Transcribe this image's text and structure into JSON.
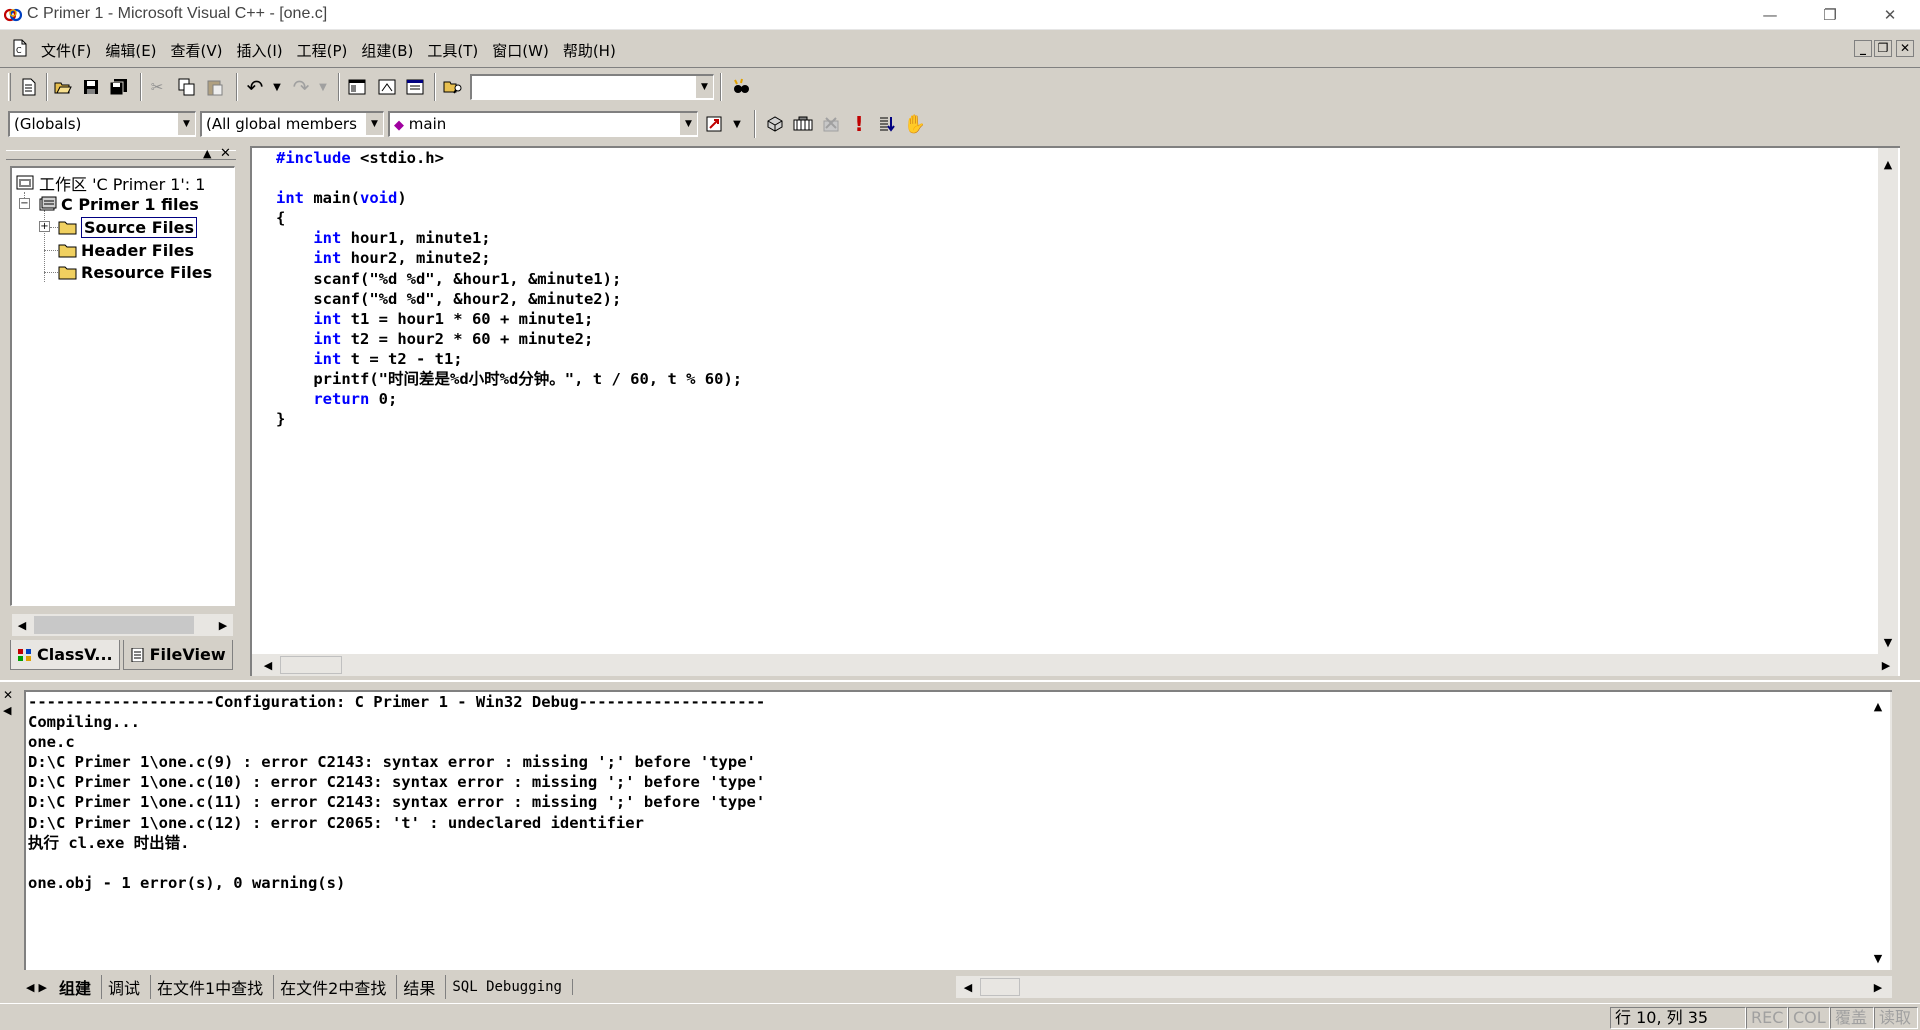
{
  "window": {
    "title": "C Primer 1 - Microsoft Visual C++ - [one.c]",
    "controls": [
      "—",
      "❐",
      "✕"
    ]
  },
  "menu": {
    "items": [
      "文件(F)",
      "编辑(E)",
      "查看(V)",
      "插入(I)",
      "工程(P)",
      "组建(B)",
      "工具(T)",
      "窗口(W)",
      "帮助(H)"
    ],
    "mdi_controls": [
      "_",
      "❐",
      "✕"
    ]
  },
  "toolbar": {
    "find_combo_value": ""
  },
  "wizardbar": {
    "class_combo": "(Globals)",
    "filter_combo": "(All global members",
    "member_combo": "main"
  },
  "workspace": {
    "root": "工作区 'C Primer 1': 1",
    "project": "C Primer 1 files",
    "folders": [
      "Source Files",
      "Header Files",
      "Resource Files"
    ],
    "tabs": [
      "ClassV...",
      "FileView"
    ]
  },
  "editor": {
    "lines": [
      [
        [
          "kw",
          "#include"
        ],
        [
          "",
          " <stdio.h>"
        ]
      ],
      [],
      [
        [
          "kw",
          "int"
        ],
        [
          "",
          " main("
        ],
        [
          "kw",
          "void"
        ],
        [
          "",
          ")"
        ]
      ],
      [
        [
          "",
          "{"
        ]
      ],
      [
        [
          "",
          "    "
        ],
        [
          "kw",
          "int"
        ],
        [
          "",
          " hour1, minute1;"
        ]
      ],
      [
        [
          "",
          "    "
        ],
        [
          "kw",
          "int"
        ],
        [
          "",
          " hour2, minute2;"
        ]
      ],
      [
        [
          "",
          "    scanf(\"%d %d\", &hour1, &minute1);"
        ]
      ],
      [
        [
          "",
          "    scanf(\"%d %d\", &hour2, &minute2);"
        ]
      ],
      [
        [
          "",
          "    "
        ],
        [
          "kw",
          "int"
        ],
        [
          "",
          " t1 = hour1 * 60 + minute1;"
        ]
      ],
      [
        [
          "",
          "    "
        ],
        [
          "kw",
          "int"
        ],
        [
          "",
          " t2 = hour2 * 60 + minute2;"
        ]
      ],
      [
        [
          "",
          "    "
        ],
        [
          "kw",
          "int"
        ],
        [
          "",
          " t = t2 - t1;"
        ]
      ],
      [
        [
          "",
          "    printf(\"时间差是%d小时%d分钟。\", t / 60, t % 60);"
        ]
      ],
      [
        [
          "",
          "    "
        ],
        [
          "kw",
          "return"
        ],
        [
          "",
          " 0;"
        ]
      ],
      [
        [
          "",
          "}"
        ]
      ]
    ]
  },
  "output": {
    "lines": [
      "--------------------Configuration: C Primer 1 - Win32 Debug--------------------",
      "Compiling...",
      "one.c",
      "D:\\C Primer 1\\one.c(9) : error C2143: syntax error : missing ';' before 'type'",
      "D:\\C Primer 1\\one.c(10) : error C2143: syntax error : missing ';' before 'type'",
      "D:\\C Primer 1\\one.c(11) : error C2143: syntax error : missing ';' before 'type'",
      "D:\\C Primer 1\\one.c(12) : error C2065: 't' : undeclared identifier",
      "执行 cl.exe 时出错.",
      "",
      "one.obj - 1 error(s), 0 warning(s)"
    ],
    "tabs": [
      "组建",
      "调试",
      "在文件1中查找",
      "在文件2中查找",
      "结果",
      "SQL Debugging"
    ],
    "active_tab": 0
  },
  "status": {
    "position": "行 10, 列 35",
    "rec": "REC",
    "col": "COL",
    "ovr": "覆盖",
    "read": "读取"
  }
}
